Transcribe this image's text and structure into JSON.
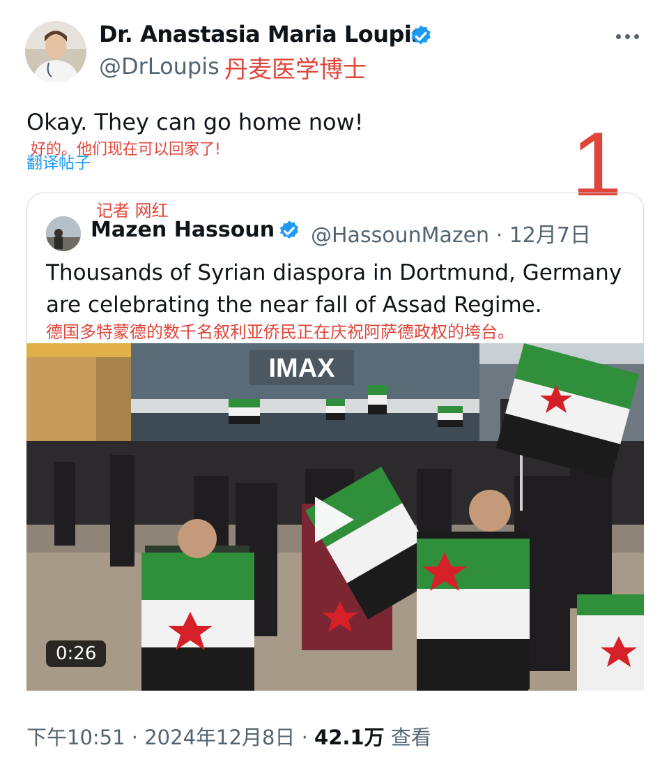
{
  "author": {
    "name": "Dr. Anastasia Maria Loupis",
    "handle": "@DrLoupis",
    "annotation": "丹麦医学博士"
  },
  "tweet": {
    "text": "Okay. They can go home now!",
    "translation_annotation": "好的。他们现在可以回家了!",
    "translate_label": "翻译帖子"
  },
  "annotations": {
    "number": "1",
    "reporter": "记者 网红"
  },
  "quote": {
    "name": "Mazen Hassoun",
    "handle": "@HassounMazen",
    "date": "12月7日",
    "separator": " · ",
    "text": "Thousands of Syrian diaspora in Dortmund, Germany are celebrating the near fall of Assad Regime.",
    "translation_annotation": "德国多特蒙德的数千名叙利亚侨民正在庆祝阿萨德政权的垮台。",
    "video": {
      "duration": "0:26",
      "sign_text": "IMAX"
    }
  },
  "footer": {
    "time": "下午10:51",
    "date": "2024年12月8日",
    "separator": " · ",
    "views_count": "42.1万",
    "views_label": "查看"
  },
  "colors": {
    "accent": "#1d9bf0",
    "annotation_red": "#e0453a",
    "secondary_text": "#536471",
    "flag_green": "#2f8f3a",
    "flag_red": "#d62028"
  },
  "icons": [
    "verified-badge-icon",
    "more-icon",
    "play-icon"
  ]
}
